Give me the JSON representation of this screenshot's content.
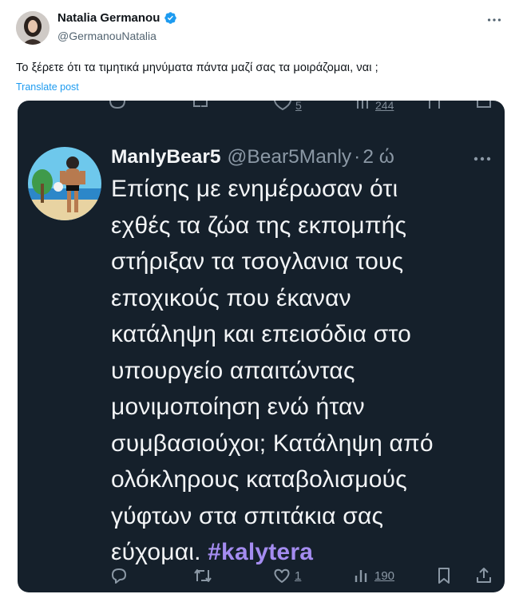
{
  "post": {
    "author_name": "Natalia Germanou",
    "handle": "@GermanouNatalia",
    "text": "Το ξέρετε ότι τα τιμητικά μηνύματα πάντα μαζί σας τα μοιράζομαι, ναι ;",
    "translate_label": "Translate post",
    "verified_color": "#1d9bf0"
  },
  "embedded_screenshot": {
    "background": "#15202b",
    "previous_tweet_actions": {
      "likes": "5",
      "views": "244"
    },
    "quoted_tweet": {
      "author_name": "ManlyBear5",
      "handle": "@Bear5Manly",
      "separator": "·",
      "time": "2 ώ",
      "body_lines": [
        "Επίσης με ενημέρωσαν ότι",
        "εχθές τα ζώα της εκπομπής",
        "στήριξαν τα τσογλανια τους",
        "εποχικούς που έκαναν",
        "κατάληψη και επεισόδια στο",
        "υπουργείο απαιτώντας",
        "μονιμοποίηση ενώ ήταν",
        "συμβασιούχοι; Κατάληψη από",
        "ολόκληρους καταβολισμούς",
        "γύφτων στα σπιτάκια σας"
      ],
      "last_line_text": "εύχομαι. ",
      "hashtag": "#kalytera",
      "hashtag_color": "#a48cf0",
      "actions": {
        "replies": "",
        "reposts": "",
        "likes": "1",
        "views": "190"
      }
    }
  }
}
